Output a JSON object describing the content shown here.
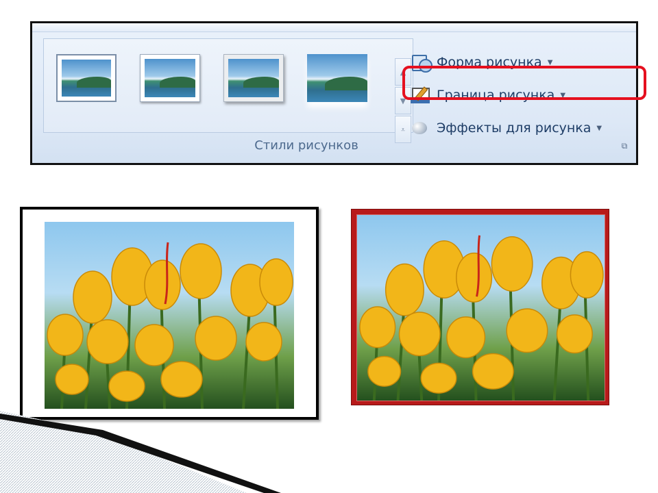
{
  "ribbon": {
    "commands": [
      {
        "label": "Форма рисунка",
        "icon": "picture-shape-icon"
      },
      {
        "label": "Граница рисунка",
        "icon": "picture-border-icon"
      },
      {
        "label": "Эффекты для рисунка",
        "icon": "picture-effects-icon"
      }
    ],
    "group_label": "Стили рисунков",
    "highlight_color": "#e5101f"
  },
  "gallery": {
    "styles": [
      "simple-frame-white",
      "soft-shadow-white",
      "thick-matte-gray",
      "reflected-soft-edge"
    ]
  },
  "examples": {
    "left_border_color": "#000000",
    "right_border_color": "#b81a1a"
  }
}
